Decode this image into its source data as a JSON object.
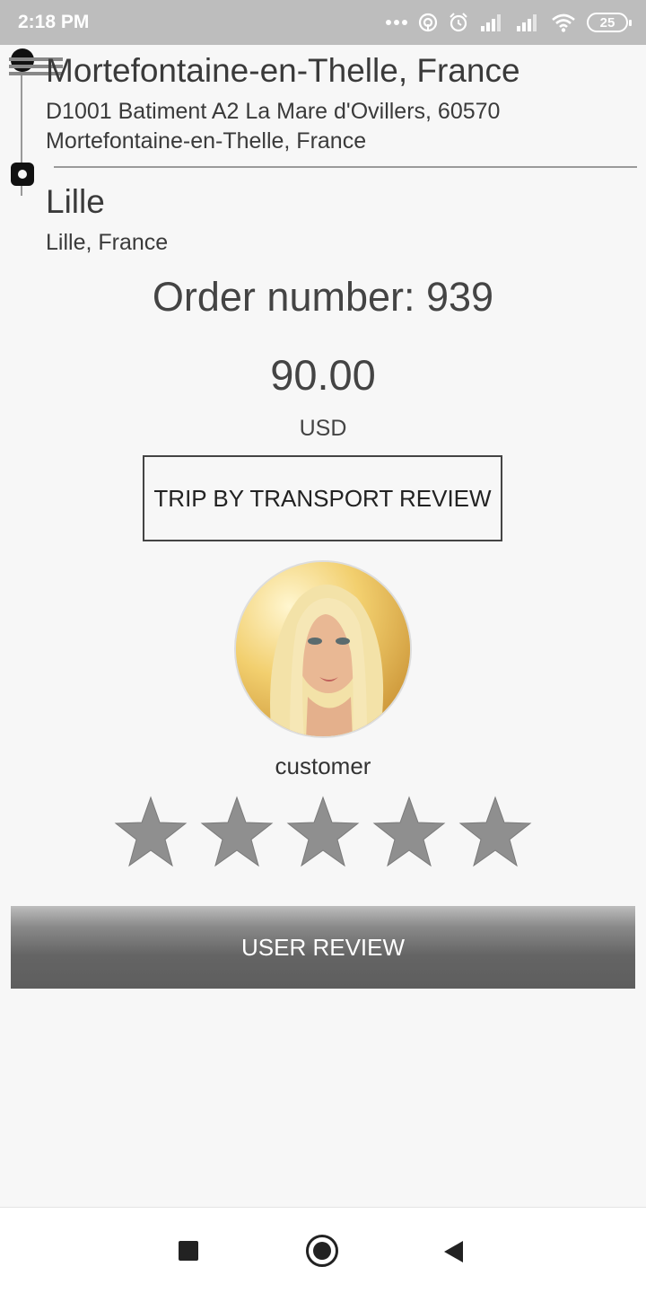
{
  "status_bar": {
    "time": "2:18 PM",
    "battery": "25",
    "icons": [
      "more-dots-icon",
      "hotspot-icon",
      "alarm-icon",
      "signal-icon",
      "signal-icon",
      "wifi-icon",
      "battery-icon"
    ]
  },
  "route": {
    "from": {
      "title": "Mortefontaine-en-Thelle, France",
      "address": "D1001 Batiment A2 La Mare d'Ovillers, 60570 Mortefontaine-en-Thelle, France"
    },
    "to": {
      "title": "Lille",
      "address": "Lille, France"
    }
  },
  "order": {
    "number_text": "Order number: 939",
    "amount": "90.00",
    "currency": "USD"
  },
  "trip_review_button": "TRIP BY TRANSPORT REVIEW",
  "customer": {
    "label": "customer"
  },
  "rating": {
    "max": 5,
    "value": 0,
    "star_color": "#8f8f8f"
  },
  "user_review_button": "USER REVIEW",
  "nav": {
    "icons": [
      "recent-apps-icon",
      "home-icon",
      "back-icon"
    ]
  }
}
